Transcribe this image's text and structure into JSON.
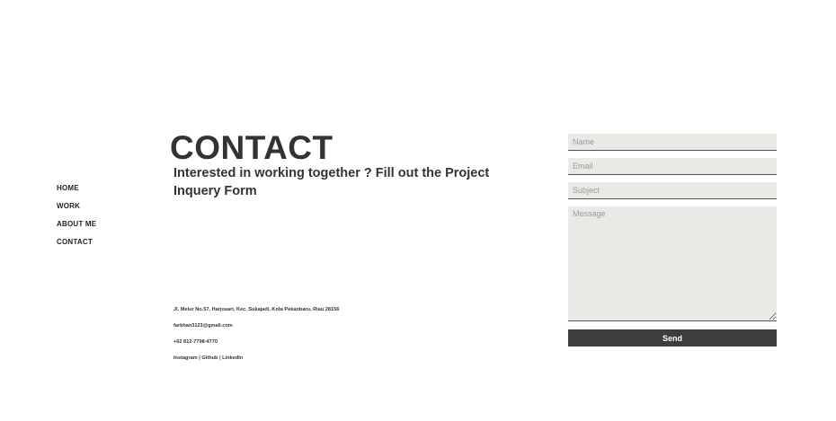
{
  "nav": {
    "items": [
      {
        "label": "HOME"
      },
      {
        "label": "WORK"
      },
      {
        "label": "ABOUT ME"
      },
      {
        "label": "CONTACT"
      }
    ]
  },
  "main": {
    "title": "CONTACT",
    "subtitle": "Interested in working together ? Fill out the Project Inquery Form"
  },
  "contact_info": {
    "address": "Jl. Melur No.57, Harjosari, Kec. Sukajadi, Kota Pekanbaru, Riau 28156",
    "email": "farkhan3123@gmail.com",
    "phone": "+62 812-7798-4770",
    "social": {
      "instagram": "Instagram",
      "separator": " | ",
      "github": "Github",
      "linkedin": "LinkedIn"
    }
  },
  "form": {
    "name_placeholder": "Name",
    "email_placeholder": "Email",
    "subject_placeholder": "Subject",
    "message_placeholder": "Message",
    "send_label": "Send"
  },
  "colors": {
    "background": "#ffffff",
    "text": "#333333",
    "field_background": "#ebe9e6",
    "button_background": "#3d3d3d",
    "button_text": "#ffffff"
  }
}
